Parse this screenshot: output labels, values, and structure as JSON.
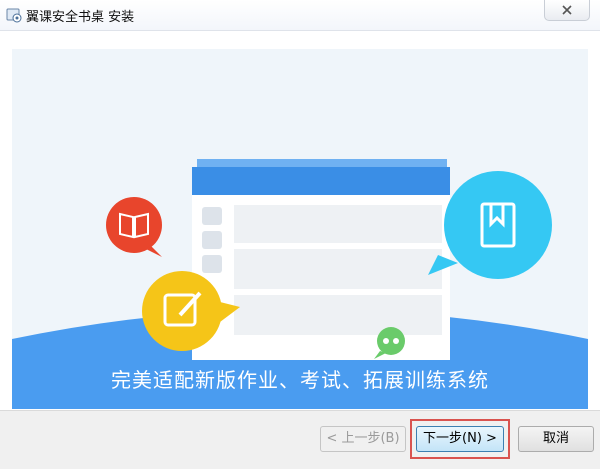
{
  "window": {
    "title": "翼课安全书桌 安装"
  },
  "banner": {
    "slogan": "完美适配新版作业、考试、拓展训练系统",
    "icons": [
      "book-icon",
      "edit-icon",
      "bookmark-icon",
      "chat-icon"
    ],
    "colors": {
      "sky": "#eff5fa",
      "hill": "#4a9cf0",
      "red_bubble": "#e8452c",
      "yellow_bubble": "#f5c518",
      "cyan_bubble": "#35c8f3",
      "green_bubble": "#6acb6a",
      "card_blue": "#3a8ee6"
    }
  },
  "footer": {
    "prev_label": "< 上一步(B)",
    "next_label": "下一步(N) >",
    "cancel_label": "取消"
  }
}
